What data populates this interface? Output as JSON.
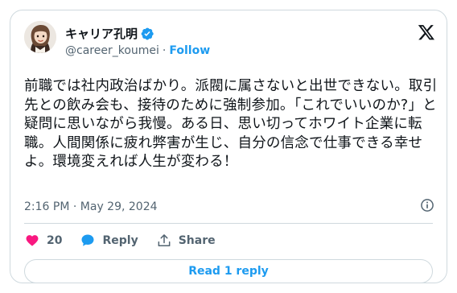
{
  "author": {
    "name": "キャリア孔明",
    "handle": "@career_koumei",
    "separator": "·",
    "follow_label": "Follow"
  },
  "tweet": {
    "text": "前職では社内政治ばかり。派閥に属さないと出世できない。取引先との飲み会も、接待のために強制参加。「これでいいのか?」と疑問に思いながら我慢。ある日、思い切ってホワイト企業に転職。人間関係に疲れ弊害が生じ、自分の信念で仕事できる幸せよ。環境変えれば人生が変わる！",
    "time": "2:16 PM",
    "separator": "·",
    "date": "May 29, 2024"
  },
  "actions": {
    "like_count": "20",
    "reply_label": "Reply",
    "share_label": "Share"
  },
  "read_replies_label": "Read 1 reply",
  "colors": {
    "accent": "#1d9bf0",
    "like": "#f91880",
    "text": "#0f1419",
    "muted": "#536471",
    "border": "#cfd9de"
  },
  "icons": [
    "avatar",
    "verified-badge-icon",
    "x-logo-icon",
    "info-icon",
    "heart-icon",
    "reply-bubble-icon",
    "share-icon"
  ]
}
